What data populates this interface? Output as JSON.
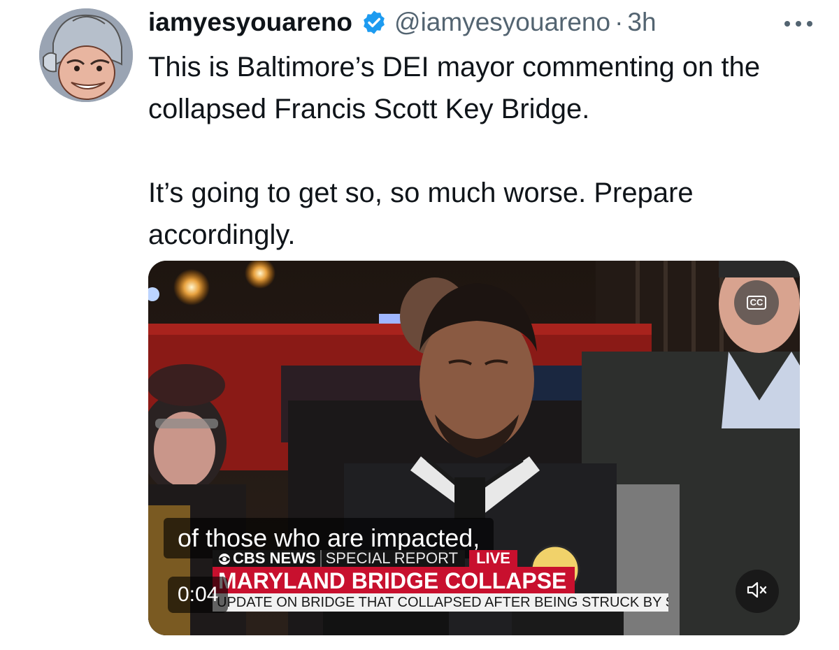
{
  "author": {
    "display_name": "iamyesyouareno",
    "handle": "@iamyesyouareno",
    "separator": "·",
    "time": "3h",
    "verified_badge_color": "#1d9bf0",
    "verified_icon": "verified-badge-icon",
    "more_icon": "more-dots-icon"
  },
  "tweet": {
    "paragraphs": [
      "This is Baltimore’s DEI mayor commenting on the collapsed Francis Scott Key Bridge.",
      "It’s going to get so, so much worse. Prepare accordingly."
    ]
  },
  "video": {
    "subtitle": "of those who are impacted,",
    "timestamp": "0:04",
    "cc_label": "CC",
    "mute_icon": "volume-muted-icon",
    "chyron": {
      "brand": "CBS NEWS",
      "report": "SPECIAL REPORT",
      "live": "LIVE",
      "headline": "MARYLAND BRIDGE COLLAPSE",
      "subheadline": "UPDATE ON BRIDGE THAT COLLAPSED AFTER BEING STRUCK BY SHIP"
    },
    "accent_red": "#c8102e"
  }
}
